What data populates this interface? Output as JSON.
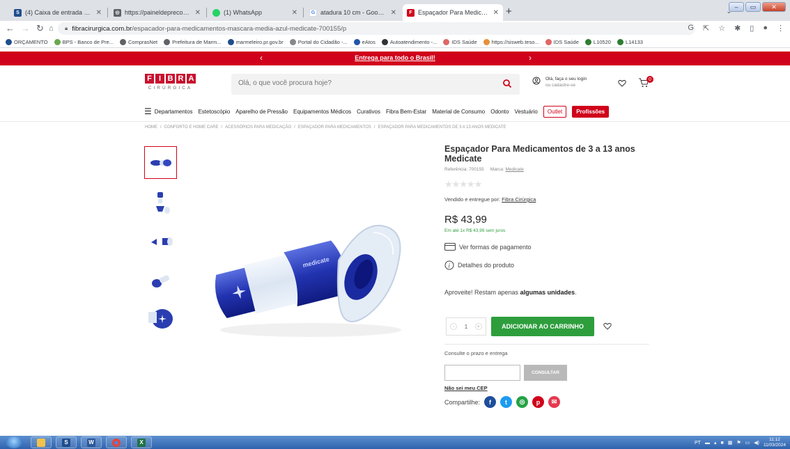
{
  "browser": {
    "tabs": [
      {
        "label": "(4) Caixa de entrada - E-mail - m",
        "icon": "s4-icon",
        "color": "#1f4e8c"
      },
      {
        "label": "https://paineldeprecos.planejam",
        "icon": "globe-icon",
        "color": "#5f6368"
      },
      {
        "label": "(1) WhatsApp",
        "icon": "whatsapp-icon",
        "color": "#25d366"
      },
      {
        "label": "atadura 10 cm - Google Shoppin",
        "icon": "google-icon",
        "color": "#4285f4"
      },
      {
        "label": "Espaçador Para Medicamentos d",
        "icon": "fibra-icon",
        "color": "#d0021b"
      }
    ],
    "new_tab": "+",
    "url_host": "fibracirurgica.com.br",
    "url_path": "/espacador-para-medicamentos-mascara-media-azul-medicate-700155/p",
    "bookmarks": [
      {
        "label": "ORÇAMENTO",
        "color": "#1f4e8c"
      },
      {
        "label": "BPS - Banco de Pre...",
        "color": "#6aa84f"
      },
      {
        "label": "ComprasNet",
        "color": "#5f6368"
      },
      {
        "label": "Prefeitura de Marm...",
        "color": "#5f6368"
      },
      {
        "label": "marmeleiro.pr.gov.br",
        "color": "#1f4e8c"
      },
      {
        "label": "Portal do Cidadão -...",
        "color": "#888888"
      },
      {
        "label": "eAtos",
        "color": "#2255aa"
      },
      {
        "label": "Autoatendimento -...",
        "color": "#333333"
      },
      {
        "label": "IDS Saúde",
        "color": "#e06666"
      },
      {
        "label": "https://sisweb.teso...",
        "color": "#e69138"
      },
      {
        "label": "IDS Saúde",
        "color": "#e06666"
      },
      {
        "label": "L10520",
        "color": "#2e7d32"
      },
      {
        "label": "L14133",
        "color": "#2e7d32"
      }
    ]
  },
  "site": {
    "promo": "Entrega para todo o Brasil!",
    "logo_word": [
      "F",
      "I",
      "B",
      "R",
      "A"
    ],
    "logo_sub": "CIRÚRGICA",
    "search_placeholder": "Olá, o que você procura hoje?",
    "login_line1": "Olá, faça o seu login",
    "login_line2": "ou cadastre-se",
    "cart_count": "0",
    "nav": [
      "Departamentos",
      "Estetoscópio",
      "Aparelho de Pressão",
      "Equipamentos Médicos",
      "Curativos",
      "Fibra Bem-Estar",
      "Material de Consumo",
      "Odonto",
      "Vestuário"
    ],
    "nav_outlet": "Outlet",
    "nav_prof": "Profissões",
    "breadcrumb": [
      "HOME",
      "/",
      "CONFORTO E HOME CARE",
      "/",
      "ACESSÓRIOS PARA MEDICAÇÃO",
      "/",
      "ESPAÇADOR PARA MEDICAMENTOS",
      "/",
      "ESPAÇADOR PARA MEDICAMENTOS DE 3 A 13 ANOS MEDICATE"
    ]
  },
  "product": {
    "title": "Espaçador Para Medicamentos de 3 a 13 anos Medicate",
    "ref_label": "Referência: 700155",
    "brand_label": "Marca:",
    "brand": "Medicate",
    "rating": 0,
    "stars": "★★★★★",
    "seller_label": "Vendido e entregue por:",
    "seller": "Fibra Cirúrgica",
    "price": "R$ 43,99",
    "installments": "Em até 1x R$ 43,99 sem juros",
    "payment_link": "Ver formas de pagamento",
    "details_link": "Detalhes do produto",
    "stock_prefix": "Aproveite! Restam apenas",
    "stock_bold": "algumas unidades",
    "stock_suffix": ".",
    "qty": "1",
    "qty_minus": "-",
    "qty_plus": "+",
    "add_to_cart": "ADICIONAR AO CARRINHO",
    "ship_label": "Consulte o prazo e entrega",
    "cep_button": "CONSULTAR",
    "no_cep": "Não sei meu CEP",
    "share_label": "Compartilhe:",
    "social": [
      {
        "name": "facebook-icon",
        "glyph": "f",
        "color": "#1e4e9c"
      },
      {
        "name": "twitter-icon",
        "glyph": "t",
        "color": "#1d9bf0"
      },
      {
        "name": "whatsapp-share-icon",
        "glyph": "w",
        "color": "#25a244"
      },
      {
        "name": "pinterest-icon",
        "glyph": "p",
        "color": "#d0021b"
      },
      {
        "name": "email-icon",
        "glyph": "✉",
        "color": "#e63950"
      }
    ]
  },
  "taskbar": {
    "lang": "PT",
    "time": "11:12",
    "date": "11/03/2024"
  }
}
